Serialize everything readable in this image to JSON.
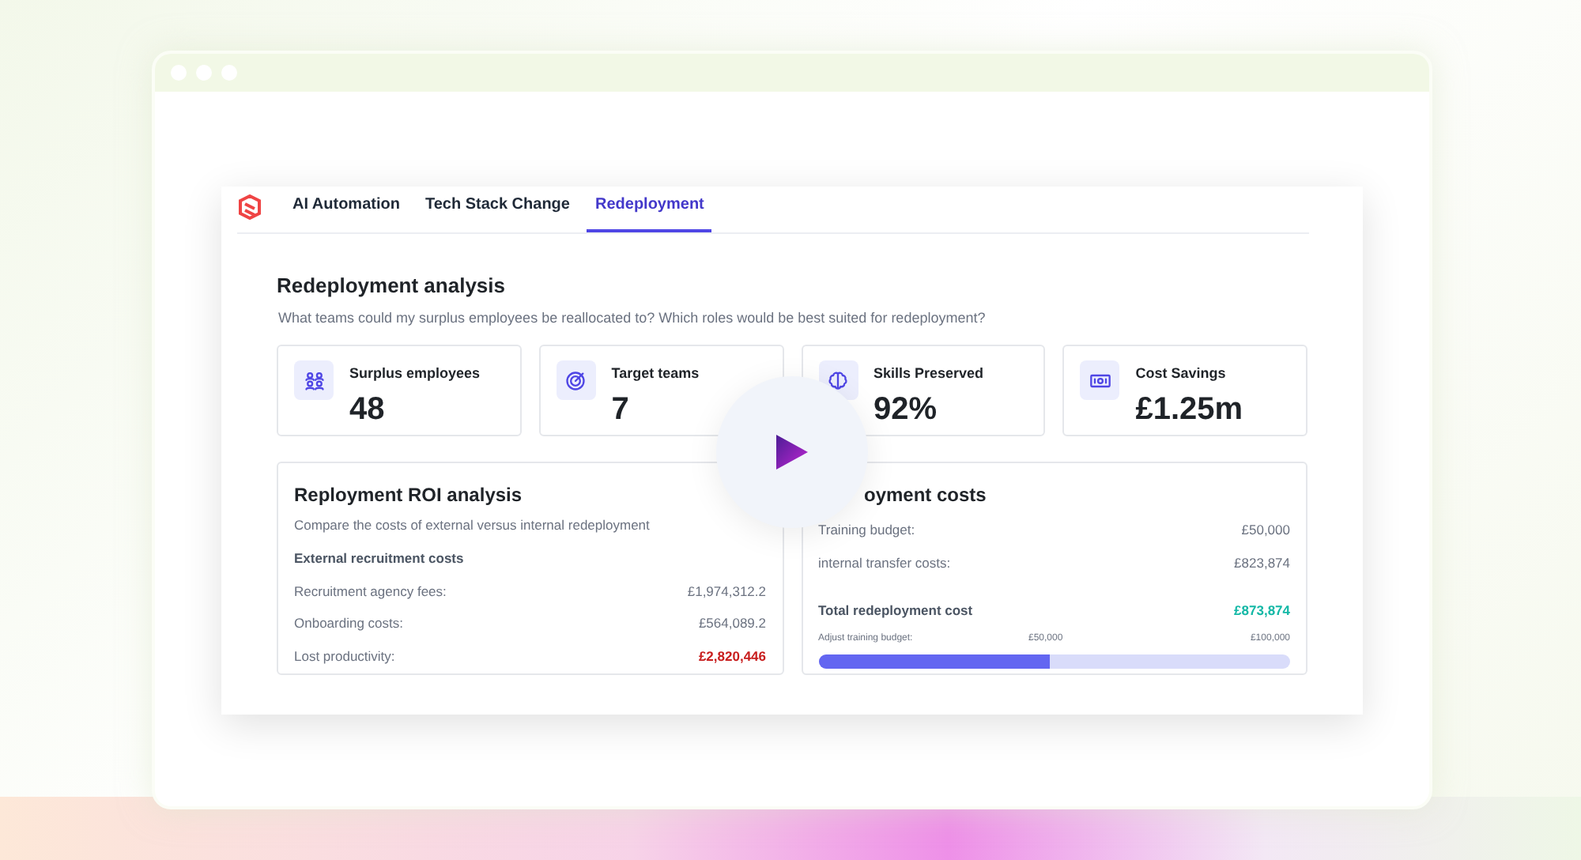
{
  "tabs": [
    {
      "label": "AI Automation",
      "selected": false
    },
    {
      "label": "Tech Stack Change",
      "selected": false
    },
    {
      "label": "Redeployment",
      "selected": true
    }
  ],
  "heading": {
    "title": "Redeployment analysis",
    "subtitle": "What teams could my surplus employees be reallocated to? Which roles would be best suited for redeployment?"
  },
  "stats": [
    {
      "kind": "people",
      "label": "Surplus employees",
      "value": "48"
    },
    {
      "kind": "target",
      "label": "Target teams",
      "value": "7"
    },
    {
      "kind": "brain",
      "label": "Skills Preserved",
      "value": "92%"
    },
    {
      "kind": "money",
      "label": "Cost Savings",
      "value": "£1.25m"
    }
  ],
  "roi_panel": {
    "title": "Reployment ROI analysis",
    "subtitle": "Compare the costs of external versus internal redeployment",
    "section": "External recruitment costs",
    "rows": [
      {
        "label": "Recruitment agency fees:",
        "value": "£1,974,312.2",
        "highlight": false
      },
      {
        "label": "Onboarding costs:",
        "value": "£564,089.2",
        "highlight": false
      },
      {
        "label": "Lost productivity:",
        "value": "£2,820,446",
        "highlight": true
      }
    ]
  },
  "costs_panel": {
    "title": "oyment costs",
    "rows": [
      {
        "label": "Training budget:",
        "value": "£50,000"
      },
      {
        "label": "internal transfer costs:",
        "value": "£823,874"
      }
    ],
    "total": {
      "label": "Total redeployment cost",
      "value": "£873,874"
    },
    "slider": {
      "label": "Adjust training budget:",
      "current": "£50,000",
      "max": "£100,000",
      "level": 0.49
    }
  }
}
